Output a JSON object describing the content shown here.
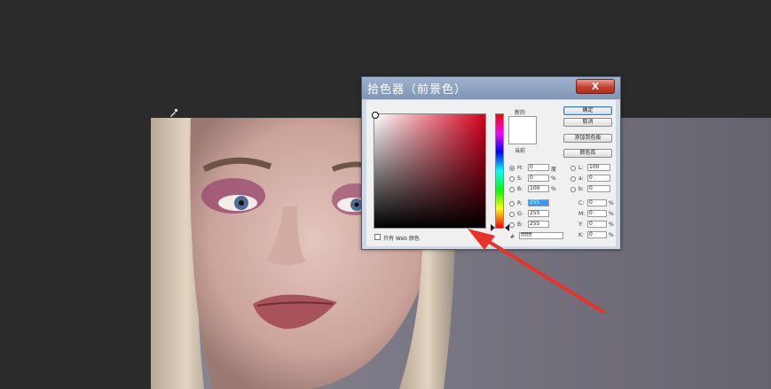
{
  "dialog": {
    "title": "拾色器（前景色）",
    "close_label": "X",
    "new_label": "新的",
    "current_label": "当前",
    "buttons": {
      "ok": "确定",
      "cancel": "取消",
      "add_to_swatches": "添加到色板",
      "color_libraries": "颜色库"
    },
    "only_web_colors": "只有 Web 颜色",
    "hsb": {
      "h_label": "H:",
      "h_value": "0",
      "h_unit": "度",
      "s_label": "S:",
      "s_value": "0",
      "s_unit": "%",
      "b_label": "B:",
      "b_value": "100",
      "b_unit": "%"
    },
    "rgb": {
      "r_label": "R:",
      "r_value": "255",
      "g_label": "G:",
      "g_value": "255",
      "b_label": "B:",
      "b_value": "255"
    },
    "lab": {
      "l_label": "L:",
      "l_value": "100",
      "a_label": "a:",
      "a_value": "0",
      "b_label": "b:",
      "b_value": "0"
    },
    "cmyk": {
      "c_label": "C:",
      "c_value": "0",
      "c_unit": "%",
      "m_label": "M:",
      "m_value": "0",
      "m_unit": "%",
      "y_label": "Y:",
      "y_value": "0",
      "y_unit": "%",
      "k_label": "K:",
      "k_value": "0",
      "k_unit": "%"
    },
    "hex_label": "#",
    "hex_value": "ffffff"
  },
  "colors": {
    "background": "#2b2b2b",
    "annotation_arrow": "#e8332a",
    "new_color": "#ffffff"
  }
}
